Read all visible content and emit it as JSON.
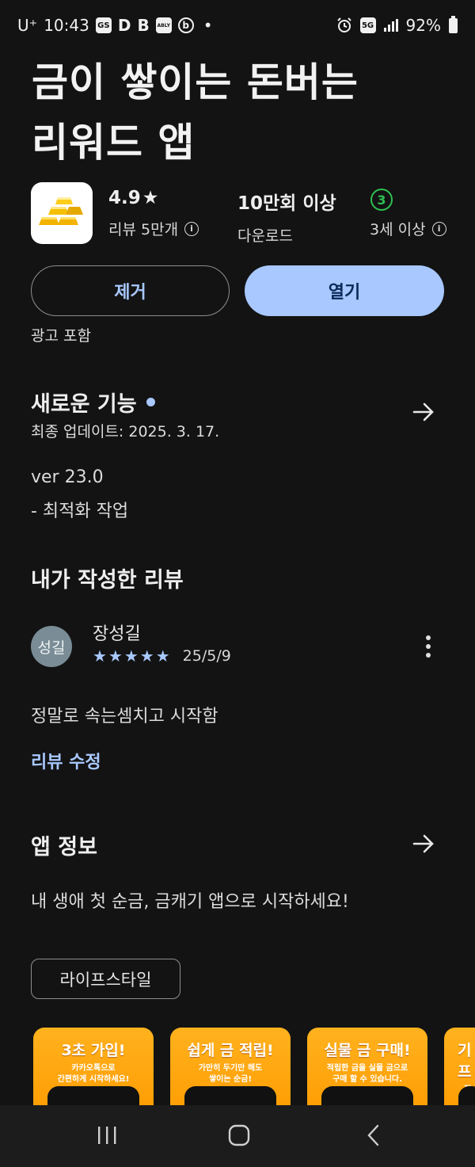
{
  "status_bar": {
    "carrier": "U⁺",
    "time": "10:43",
    "notif_icons": [
      "GS",
      "D",
      "B",
      "ABLY",
      "b"
    ],
    "more_dot": "•",
    "network": "5G",
    "battery": "92%"
  },
  "app": {
    "title_line1": "금이 쌓이는 돈버는",
    "title_line2": "리워드 앱",
    "rating": "4.9",
    "rating_star": "★",
    "reviews": "리뷰 5만개",
    "downloads": "10만회 이상",
    "downloads_label": "다운로드",
    "age_badge": "3",
    "age_label": "3세 이상",
    "ads_note": "광고 포함"
  },
  "buttons": {
    "remove": "제거",
    "open": "열기"
  },
  "whats_new": {
    "heading": "새로운 기능",
    "updated": "최종 업데이트: 2025. 3. 17.",
    "version": "ver 23.0",
    "note": "- 최적화 작업"
  },
  "my_review": {
    "heading": "내가 작성한 리뷰",
    "avatar_text": "성길",
    "author": "장성길",
    "stars": "★★★★★",
    "date": "25/5/9",
    "text": "정말로 속는셈치고 시작함",
    "edit_link": "리뷰 수정"
  },
  "about": {
    "heading": "앱 정보",
    "description": "내 생애 첫 순금, 금캐기 앱으로 시작하세요!",
    "category_chip": "라이프스타일"
  },
  "screenshots": [
    {
      "title": "3초 가입!",
      "line1": "카카오톡으로",
      "line2": "간편하게 시작하세요!"
    },
    {
      "title": "쉽게 금 적립!",
      "line1": "가만히 두기만 해도",
      "line2": "쌓이는 순금!"
    },
    {
      "title": "실물 금 구매!",
      "line1": "적립한 금을 실물 금으로",
      "line2": "구매 할 수 있습니다."
    },
    {
      "title": "기프",
      "line1": "적립",
      "line2": "기프"
    }
  ],
  "colors": {
    "background": "#131313",
    "accent": "#a8c8ff",
    "age_green": "#2fbf52",
    "screenshot_orange": "#ffa514"
  }
}
